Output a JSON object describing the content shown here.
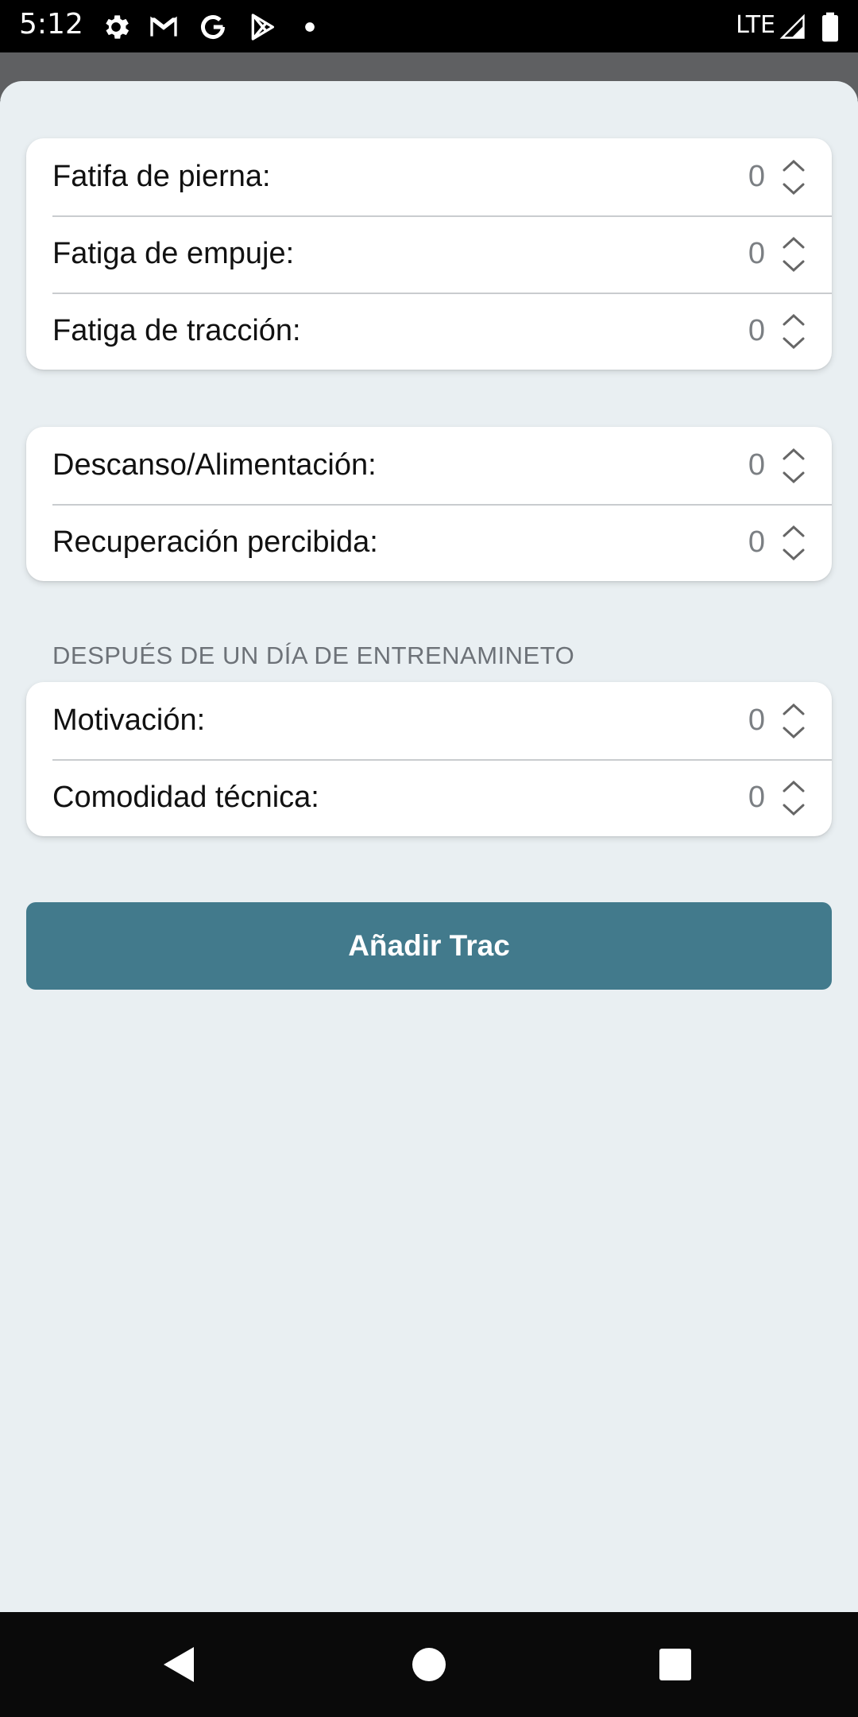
{
  "status_bar": {
    "time": "5:12",
    "network": "LTE",
    "icons": [
      "settings-icon",
      "gmail-icon",
      "google-icon",
      "play-store-icon",
      "notification-dot-icon",
      "signal-icon",
      "battery-icon"
    ]
  },
  "groups": [
    {
      "rows": [
        {
          "label": "Fatifa de pierna:",
          "value": "0"
        },
        {
          "label": "Fatiga de empuje:",
          "value": "0"
        },
        {
          "label": "Fatiga de tracción:",
          "value": "0"
        }
      ]
    },
    {
      "rows": [
        {
          "label": "Descanso/Alimentación:",
          "value": "0"
        },
        {
          "label": "Recuperación percibida:",
          "value": "0"
        }
      ]
    },
    {
      "header": "DESPUÉS DE UN DÍA DE ENTRENAMINETO",
      "rows": [
        {
          "label": "Motivación:",
          "value": "0"
        },
        {
          "label": "Comodidad técnica:",
          "value": "0"
        }
      ]
    }
  ],
  "primary_button": {
    "label": "Añadir Trac"
  },
  "colors": {
    "accent": "#427a8c",
    "background": "#e9eff2",
    "card": "#ffffff"
  },
  "nav_bar": {
    "icons": [
      "back-icon",
      "home-icon",
      "recents-icon"
    ]
  }
}
